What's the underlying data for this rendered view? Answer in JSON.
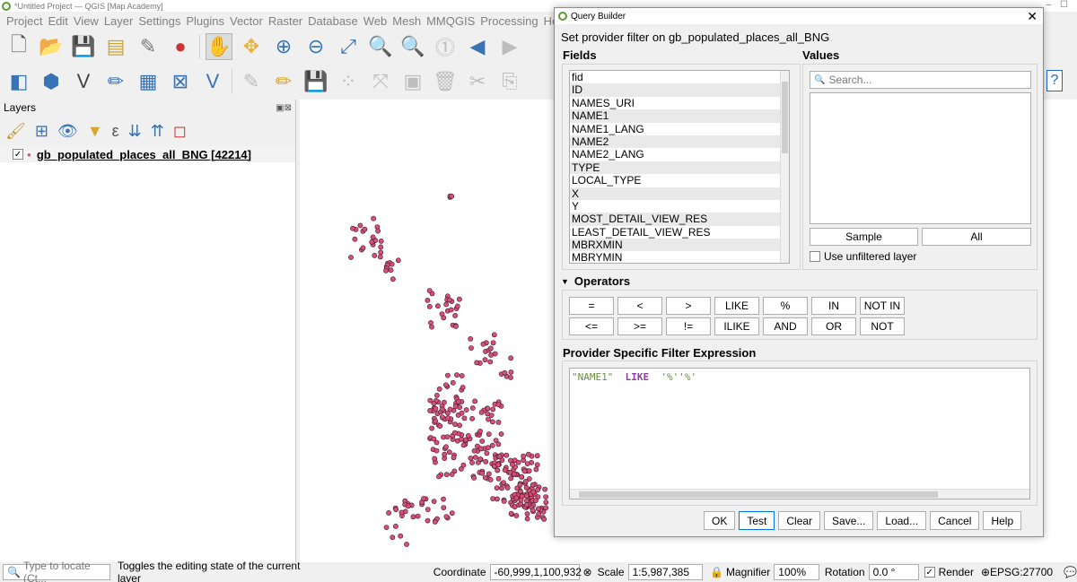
{
  "main_window": {
    "title": "*Untitled Project — QGIS [Map Academy]",
    "menu": [
      "Project",
      "Edit",
      "View",
      "Layer",
      "Settings",
      "Plugins",
      "Vector",
      "Raster",
      "Database",
      "Web",
      "Mesh",
      "MMQGIS",
      "Processing",
      "Help"
    ]
  },
  "toolbar1_icons": [
    "new-project-icon",
    "open-project-icon",
    "save-project-icon",
    "print-layout-icon",
    "layout-manager-icon",
    "style-manager-icon",
    "pan-icon",
    "pan-to-selection-icon",
    "zoom-in-icon",
    "zoom-out-icon",
    "zoom-full-icon",
    "zoom-to-selection-icon",
    "zoom-to-layer-icon",
    "zoom-native-icon",
    "zoom-last-icon",
    "zoom-next-icon"
  ],
  "toolbar2_icons": [
    "data-source-manager-icon",
    "new-geopackage-icon",
    "digitize-icon",
    "pencil-icon",
    "add-grid-icon",
    "layout-icon",
    "vertex-tool-icon",
    "edit-pencil-icon",
    "toggle-editing-icon",
    "save-edits-icon",
    "add-point-icon",
    "move-feature-icon",
    "node-tool-icon",
    "delete-icon",
    "cut-icon",
    "copy-icon"
  ],
  "layers": {
    "header": "Layers",
    "items": [
      {
        "name": "gb_populated_places_all_BNG [42214]",
        "checked": true
      }
    ]
  },
  "status": {
    "locate_placeholder": "Type to locate (Ct...",
    "message": "Toggles the editing state of the current layer",
    "coordinate_label": "Coordinate",
    "coordinate_value": "-60,999,1,100,932",
    "scale_label": "Scale",
    "scale_value": "1:5,987,385",
    "magnifier_label": "Magnifier",
    "magnifier_value": "100%",
    "rotation_label": "Rotation",
    "rotation_value": "0.0 °",
    "render_label": "Render",
    "crs": "EPSG:27700"
  },
  "dialog": {
    "title": "Query Builder",
    "subtitle": "Set provider filter on gb_populated_places_all_BNG",
    "fields_label": "Fields",
    "values_label": "Values",
    "fields": [
      "fid",
      "ID",
      "NAMES_URI",
      "NAME1",
      "NAME1_LANG",
      "NAME2",
      "NAME2_LANG",
      "TYPE",
      "LOCAL_TYPE",
      "X",
      "Y",
      "MOST_DETAIL_VIEW_RES",
      "LEAST_DETAIL_VIEW_RES",
      "MBRXMIN",
      "MBRYMIN"
    ],
    "search_placeholder": "Search...",
    "sample_label": "Sample",
    "all_label": "All",
    "unfiltered_label": "Use unfiltered layer",
    "operators_label": "Operators",
    "operators_row1": [
      "=",
      "<",
      ">",
      "LIKE",
      "%",
      "IN",
      "NOT IN"
    ],
    "operators_row2": [
      "<=",
      ">=",
      "!=",
      "ILIKE",
      "AND",
      "OR",
      "NOT"
    ],
    "expression_label": "Provider Specific Filter Expression",
    "expression": {
      "field": "\"NAME1\"",
      "operator": "LIKE",
      "value": "'%''%'"
    },
    "buttons": [
      "OK",
      "Test",
      "Clear",
      "Save...",
      "Load...",
      "Cancel",
      "Help"
    ]
  },
  "colors": {
    "point_fill": "#d94f7a",
    "point_stroke": "#3a1a26"
  }
}
